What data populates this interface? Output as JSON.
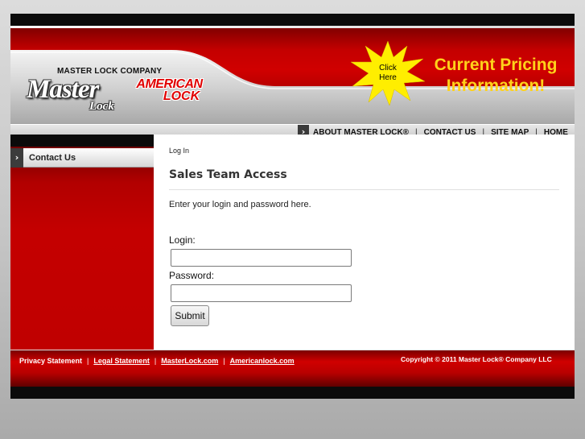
{
  "header": {
    "company_name": "MASTER LOCK COMPANY",
    "logo_master": "Master",
    "logo_lock": "Lock",
    "logo_american_1": "AMERICAN",
    "logo_american_2": "LOCK",
    "promo_click_line1": "Click",
    "promo_click_line2": "Here",
    "promo_line1": "Current Pricing",
    "promo_line2": "Information!",
    "colors": {
      "brand_red": "#c40000",
      "promo_yellow": "#ffd21a",
      "star_yellow": "#ffee00"
    }
  },
  "nav": {
    "items": [
      {
        "label": "ABOUT MASTER LOCK®"
      },
      {
        "label": "CONTACT US"
      },
      {
        "label": "SITE MAP"
      },
      {
        "label": "HOME"
      }
    ],
    "separator": "|"
  },
  "sidebar": {
    "items": [
      {
        "label": "Contact Us"
      }
    ]
  },
  "main": {
    "breadcrumb": "Log In",
    "title": "Sales Team Access",
    "intro": "Enter your login and password here.",
    "login_label": "Login:",
    "login_value": "",
    "password_label": "Password:",
    "password_value": "",
    "submit_label": "Submit"
  },
  "footer": {
    "links": [
      {
        "label": "Privacy Statement",
        "underline": false
      },
      {
        "label": "Legal Statement",
        "underline": true
      },
      {
        "label": "MasterLock.com",
        "underline": true
      },
      {
        "label": "Americanlock.com",
        "underline": true
      }
    ],
    "separator": "|",
    "copyright": "Copyright © 2011 Master Lock® Company LLC"
  }
}
